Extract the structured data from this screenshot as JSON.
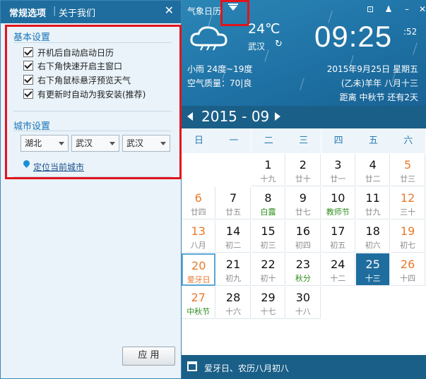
{
  "left_panel": {
    "tab_general": "常规选项",
    "tab_sep": "|",
    "tab_about": "关于我们",
    "close": "✕",
    "basic_title": "基本设置",
    "options": [
      "开机后自动启动日历",
      "右下角快速开启主窗口",
      "右下角鼠标悬浮预览天气",
      "有更新时自动为我安装(推荐)"
    ],
    "city_title": "城市设置",
    "province": "湖北",
    "city": "武汉",
    "district": "武汉",
    "locate_link": "定位当前城市",
    "apply": "应 用"
  },
  "right_panel": {
    "app_title": "气象日历",
    "temperature": "24℃",
    "city": "武汉",
    "refresh_icon": "↻",
    "clock": "09:25",
    "seconds": ":52",
    "weather": "小雨 24度~19度",
    "air_quality": "空气质量：70|良",
    "date": "2015年9月25日  星期五",
    "lunar": "(乙未)羊年  八月十三",
    "festival_countdown": "距离 中秋节 还有2天",
    "year_month": "2015 - 09",
    "weekdays": [
      "日",
      "一",
      "二",
      "三",
      "四",
      "五",
      "六"
    ],
    "status": "爱牙日、农历八月初八"
  },
  "calendar": [
    {
      "d": "1",
      "l": "十九"
    },
    {
      "d": "2",
      "l": "廿十"
    },
    {
      "d": "3",
      "l": "廿一"
    },
    {
      "d": "4",
      "l": "廿二"
    },
    {
      "d": "5",
      "l": "廿三"
    },
    {
      "d": "6",
      "l": "廿四"
    },
    {
      "d": "7",
      "l": "廿五"
    },
    {
      "d": "8",
      "l": "白露"
    },
    {
      "d": "9",
      "l": "廿七"
    },
    {
      "d": "10",
      "l": "教师节"
    },
    {
      "d": "11",
      "l": "廿九"
    },
    {
      "d": "12",
      "l": "三十"
    },
    {
      "d": "13",
      "l": "八月"
    },
    {
      "d": "14",
      "l": "初二"
    },
    {
      "d": "15",
      "l": "初三"
    },
    {
      "d": "16",
      "l": "初四"
    },
    {
      "d": "17",
      "l": "初五"
    },
    {
      "d": "18",
      "l": "初六"
    },
    {
      "d": "19",
      "l": "初七"
    },
    {
      "d": "20",
      "l": "爱牙日"
    },
    {
      "d": "21",
      "l": "初九"
    },
    {
      "d": "22",
      "l": "初十"
    },
    {
      "d": "23",
      "l": "秋分"
    },
    {
      "d": "24",
      "l": "十二"
    },
    {
      "d": "25",
      "l": "十三"
    },
    {
      "d": "26",
      "l": "十四"
    },
    {
      "d": "27",
      "l": "中秋节"
    },
    {
      "d": "28",
      "l": "十六"
    },
    {
      "d": "29",
      "l": "十七"
    },
    {
      "d": "30",
      "l": "十八"
    }
  ],
  "colors": {
    "accent": "#1f6d9e",
    "weekend": "#e8792a",
    "festival": "#2f8f1e",
    "highlight": "#e0151c"
  }
}
